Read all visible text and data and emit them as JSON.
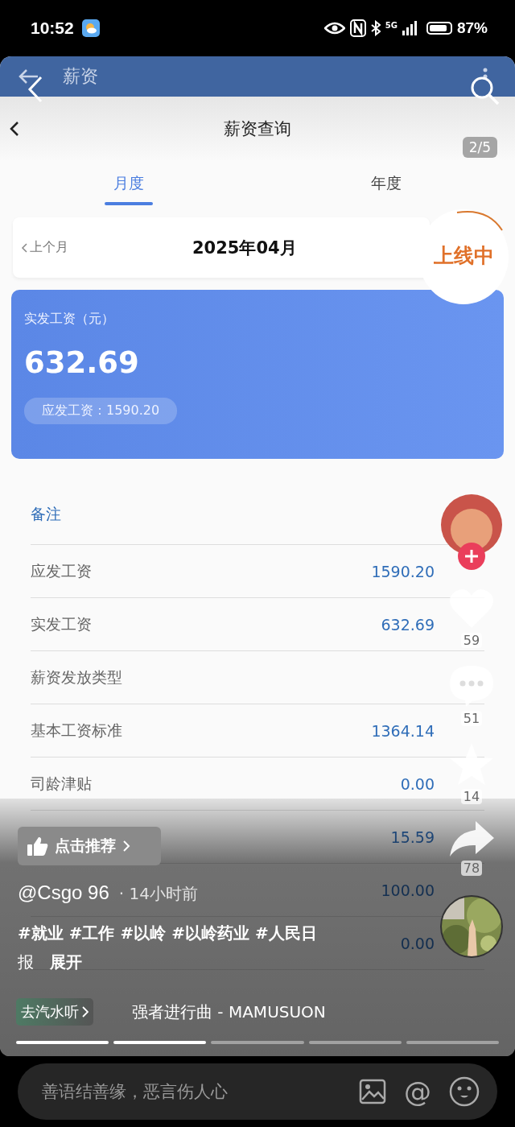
{
  "status_bar": {
    "time": "10:52",
    "network": "5G",
    "battery": "87%"
  },
  "app_header": {
    "title": "薪资"
  },
  "page": {
    "title": "薪资查询",
    "counter": "2/5"
  },
  "tabs": [
    {
      "label": "月度",
      "selected": true
    },
    {
      "label": "年度",
      "selected": false
    }
  ],
  "month_selector": {
    "prev": "上个月",
    "current": "2025年04月"
  },
  "live_badge": {
    "label": "上线中"
  },
  "summary_card": {
    "caption": "实发工资（元）",
    "amount": "632.69",
    "gross": "应发工资：1590.20"
  },
  "remark": {
    "label": "备注"
  },
  "rows": [
    {
      "label": "应发工资",
      "value": "1590.20"
    },
    {
      "label": "实发工资",
      "value": "632.69"
    },
    {
      "label": "薪资发放类型"
    },
    {
      "label": "基本工资标准",
      "value": "1364.14"
    },
    {
      "label": "司龄津贴",
      "value": "0.00"
    },
    {
      "value": "15.59"
    },
    {
      "value": "100.00"
    },
    {
      "value": "0.00"
    }
  ],
  "video": {
    "recommend": "点击推荐",
    "author": "@Csgo 96",
    "time": "· 14小时前",
    "tags": "#就业 #工作 #以岭 #以岭药业 #人民日",
    "tags_more": "报",
    "expand": "展开",
    "listen": "去汽水听",
    "song": "强者进行曲 - MAMUSUON",
    "segments": [
      {
        "filled": true
      },
      {
        "filled": true
      },
      {
        "filled": false
      },
      {
        "filled": false
      },
      {
        "filled": false
      }
    ],
    "actions": [
      {
        "kind": "like",
        "count": "59"
      },
      {
        "kind": "comment",
        "count": "51"
      },
      {
        "kind": "favorite",
        "count": "14"
      },
      {
        "kind": "share",
        "count": "78"
      }
    ]
  },
  "comment_bar": {
    "placeholder": "善语结善缘，恶言伤人心",
    "mention": "@"
  }
}
